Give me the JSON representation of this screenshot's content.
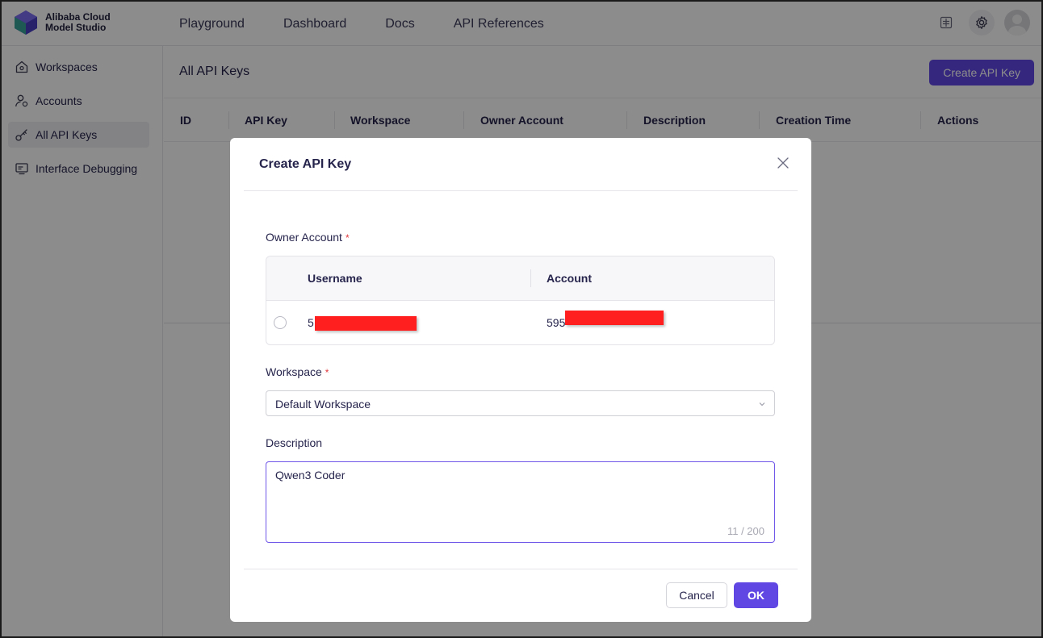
{
  "brand": {
    "line1": "Alibaba Cloud",
    "line2": "Model Studio"
  },
  "nav": {
    "items": [
      "Playground",
      "Dashboard",
      "Docs",
      "API References"
    ]
  },
  "top_icons": [
    "layout-icon",
    "gear-icon",
    "avatar"
  ],
  "sidebar": {
    "items": [
      {
        "label": "Workspaces",
        "icon": "home-icon",
        "active": false
      },
      {
        "label": "Accounts",
        "icon": "user-icon",
        "active": false
      },
      {
        "label": "All API Keys",
        "icon": "key-icon",
        "active": true
      },
      {
        "label": "Interface Debugging",
        "icon": "monitor-icon",
        "active": false
      }
    ]
  },
  "main": {
    "title": "All API Keys",
    "create_button": "Create API Key",
    "columns": [
      "ID",
      "API Key",
      "Workspace",
      "Owner Account",
      "Description",
      "Creation Time",
      "Actions"
    ]
  },
  "modal": {
    "title": "Create API Key",
    "owner_label": "Owner Account",
    "owner_table": {
      "headers": [
        "Username",
        "Account"
      ],
      "row": {
        "username_visible": "5",
        "account_visible": "595"
      }
    },
    "workspace_label": "Workspace",
    "workspace_value": "Default Workspace",
    "description_label": "Description",
    "description_value": "Qwen3 Coder",
    "counter": "11 / 200",
    "cancel_label": "Cancel",
    "ok_label": "OK"
  },
  "colors": {
    "accent": "#6047e3",
    "required": "#e0393e",
    "redaction": "#ff1f1f"
  }
}
